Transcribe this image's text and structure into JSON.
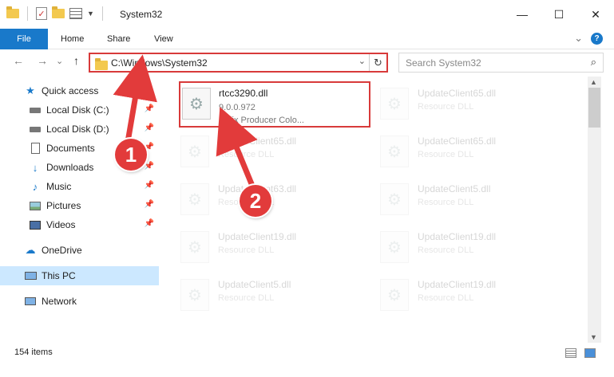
{
  "window": {
    "title": "System32",
    "minimize_glyph": "—",
    "maximize_glyph": "☐",
    "close_glyph": "✕"
  },
  "ribbon": {
    "tabs": [
      "File",
      "Home",
      "Share",
      "View"
    ],
    "expand_glyph": "⌄",
    "help_glyph": "?"
  },
  "navigation": {
    "back_glyph": "←",
    "forward_glyph": "→",
    "recent_glyph": "⌄",
    "up_glyph": "↑",
    "address": "C:\\Windows\\System32",
    "address_dropdown_glyph": "⌄",
    "refresh_glyph": "↻",
    "search_placeholder": "Search System32",
    "search_glyph": "⌕"
  },
  "sidebar": {
    "items": [
      {
        "label": "Quick access",
        "icon": "star-icon",
        "pinned": false
      },
      {
        "label": "Local Disk (C:)",
        "icon": "drive-icon",
        "pinned": true
      },
      {
        "label": "Local Disk (D:)",
        "icon": "drive-icon",
        "pinned": true
      },
      {
        "label": "Documents",
        "icon": "documents-icon",
        "pinned": true
      },
      {
        "label": "Downloads",
        "icon": "downloads-icon",
        "pinned": true
      },
      {
        "label": "Music",
        "icon": "music-icon",
        "pinned": true
      },
      {
        "label": "Pictures",
        "icon": "pictures-icon",
        "pinned": true
      },
      {
        "label": "Videos",
        "icon": "videos-icon",
        "pinned": true
      },
      {
        "label": "OneDrive",
        "icon": "cloud-icon",
        "pinned": false
      },
      {
        "label": "This PC",
        "icon": "computer-icon",
        "pinned": false,
        "selected": true
      },
      {
        "label": "Network",
        "icon": "network-icon",
        "pinned": false
      }
    ],
    "pin_glyph": "📌"
  },
  "files": [
    {
      "name": "rtcc3290.dll",
      "line2": "9.0.0.972",
      "line3": "Helix Producer Colo...",
      "highlighted": true
    },
    {
      "name": "UpdateClient65.dll",
      "line2": "Resource DLL"
    },
    {
      "name": "UpdateClient65.dll",
      "line2": "Resource DLL"
    },
    {
      "name": "UpdateClient65.dll",
      "line2": "Resource DLL"
    },
    {
      "name": "UpdateClient63.dll",
      "line2": "Resource DLL"
    },
    {
      "name": "UpdateClient5.dll",
      "line2": "Resource DLL"
    },
    {
      "name": "UpdateClient19.dll",
      "line2": "Resource DLL"
    },
    {
      "name": "UpdateClient19.dll",
      "line2": "Resource DLL"
    },
    {
      "name": "UpdateClient5.dll",
      "line2": "Resource DLL"
    },
    {
      "name": "UpdateClient19.dll",
      "line2": "Resource DLL"
    }
  ],
  "status": {
    "item_count": "154 items"
  },
  "annotations": {
    "step1": "1",
    "step2": "2",
    "arrow_color": "#e23b3b"
  },
  "colors": {
    "accent": "#1979ca",
    "highlight_border": "#d83a3a",
    "selected_bg": "#cce8ff"
  }
}
